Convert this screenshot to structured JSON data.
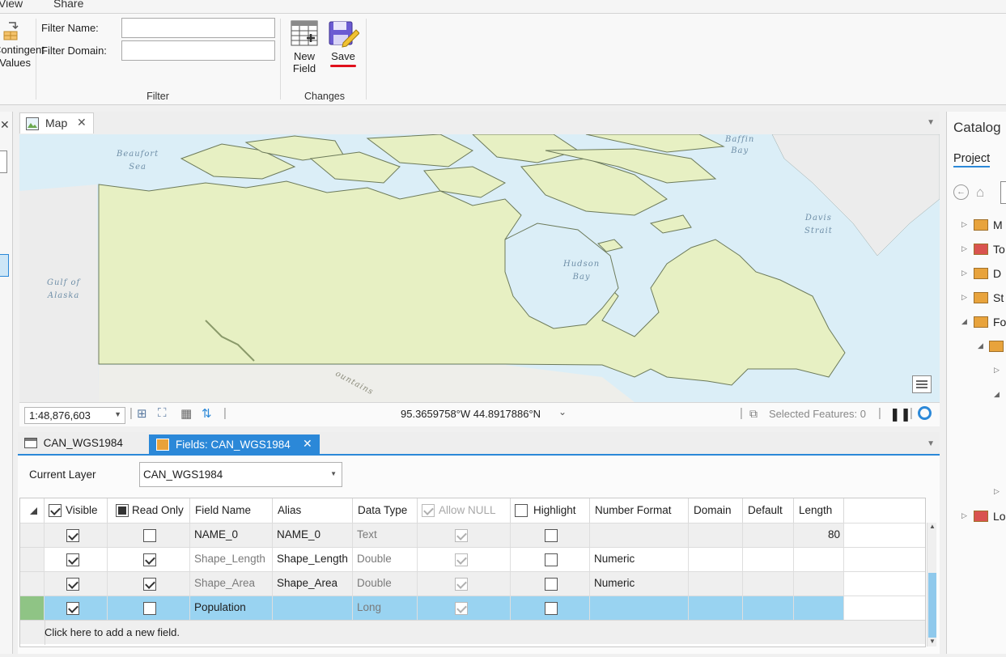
{
  "ribbon": {
    "tabs": [
      "View",
      "Share"
    ],
    "contingent_label": "Contingent\nValues",
    "filter_name_label": "Filter Name:",
    "filter_domain_label": "Filter Domain:",
    "filter_name_value": "",
    "filter_domain_value": "",
    "filter_group_label": "Filter",
    "new_field_label": "New\nField",
    "save_label": "Save",
    "changes_group_label": "Changes"
  },
  "map_view": {
    "tab_label": "Map",
    "labels": {
      "beaufort": "Beaufort\nSea",
      "gulf": "Gulf of\nAlaska",
      "hudson": "Hudson\nBay",
      "baffin": "Baffin\nBay",
      "davis": "Davis\nStrait",
      "mountains": "ountains"
    },
    "scale": "1:48,876,603",
    "coordinates": "95.3659758°W 44.8917886°N",
    "selected_features": "Selected Features: 0"
  },
  "table_tabs": {
    "attribute_tab": "CAN_WGS1984",
    "fields_tab": "Fields: CAN_WGS1984"
  },
  "fields_view": {
    "current_layer_label": "Current Layer",
    "current_layer_value": "CAN_WGS1984",
    "columns": [
      "Visible",
      "Read Only",
      "Field Name",
      "Alias",
      "Data Type",
      "Allow NULL",
      "Highlight",
      "Number Format",
      "Domain",
      "Default",
      "Length"
    ],
    "rows": [
      {
        "visible": true,
        "read_only": false,
        "field_name": "NAME_0",
        "alias": "NAME_0",
        "data_type": "Text",
        "allow_null": true,
        "highlight": false,
        "number_format": "",
        "domain": "",
        "default": "",
        "length": "80",
        "name_gray": false
      },
      {
        "visible": true,
        "read_only": true,
        "field_name": "Shape_Length",
        "alias": "Shape_Length",
        "data_type": "Double",
        "allow_null": true,
        "highlight": false,
        "number_format": "Numeric",
        "domain": "",
        "default": "",
        "length": "",
        "name_gray": true
      },
      {
        "visible": true,
        "read_only": true,
        "field_name": "Shape_Area",
        "alias": "Shape_Area",
        "data_type": "Double",
        "allow_null": true,
        "highlight": false,
        "number_format": "Numeric",
        "domain": "",
        "default": "",
        "length": "",
        "name_gray": true
      },
      {
        "visible": true,
        "read_only": false,
        "field_name": "Population",
        "alias": "",
        "data_type": "Long",
        "allow_null": true,
        "highlight": false,
        "number_format": "",
        "domain": "",
        "default": "",
        "length": "",
        "name_gray": false
      }
    ],
    "add_field_text": "Click here to add a new field."
  },
  "catalog": {
    "title": "Catalog",
    "tab": "Project",
    "items": [
      "M",
      "To",
      "D",
      "St",
      "Fo",
      "",
      "",
      "",
      "",
      "Lo"
    ]
  },
  "colors": {
    "accent": "#2b88d8",
    "selected_row": "#99d3f1",
    "land": "#e7f0c3",
    "water": "#dbeef7"
  }
}
